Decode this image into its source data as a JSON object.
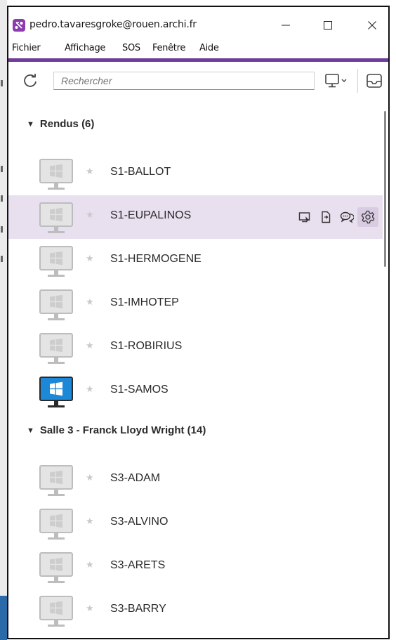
{
  "window": {
    "title": "pedro.tavaresgroke@rouen.archi.fr",
    "controls": {
      "minimize": "—",
      "close": "✕"
    }
  },
  "menu": [
    "Fichier",
    "Affichage",
    "SOS",
    "Fenêtre",
    "Aide"
  ],
  "toolbar": {
    "search_placeholder": "Rechercher"
  },
  "colors": {
    "accent": "#6f3d99",
    "selected_row": "#e9e0ef",
    "windows_blue": "#1e88d8"
  },
  "groups": [
    {
      "title": "Rendus (6)",
      "expanded": true,
      "computers": [
        {
          "name": "S1-BALLOT",
          "online": false
        },
        {
          "name": "S1-EUPALINOS",
          "online": false,
          "selected": true,
          "actions": [
            "remote-control-icon",
            "file-transfer-icon",
            "chat-icon",
            "settings-icon"
          ]
        },
        {
          "name": "S1-HERMOGENE",
          "online": false
        },
        {
          "name": "S1-IMHOTEP",
          "online": false
        },
        {
          "name": "S1-ROBIRIUS",
          "online": false
        },
        {
          "name": "S1-SAMOS",
          "online": true
        }
      ]
    },
    {
      "title": "Salle 3 - Franck Lloyd Wright (14)",
      "expanded": true,
      "computers": [
        {
          "name": "S3-ADAM",
          "online": false
        },
        {
          "name": "S3-ALVINO",
          "online": false
        },
        {
          "name": "S3-ARETS",
          "online": false
        },
        {
          "name": "S3-BARRY",
          "online": false
        }
      ]
    }
  ]
}
